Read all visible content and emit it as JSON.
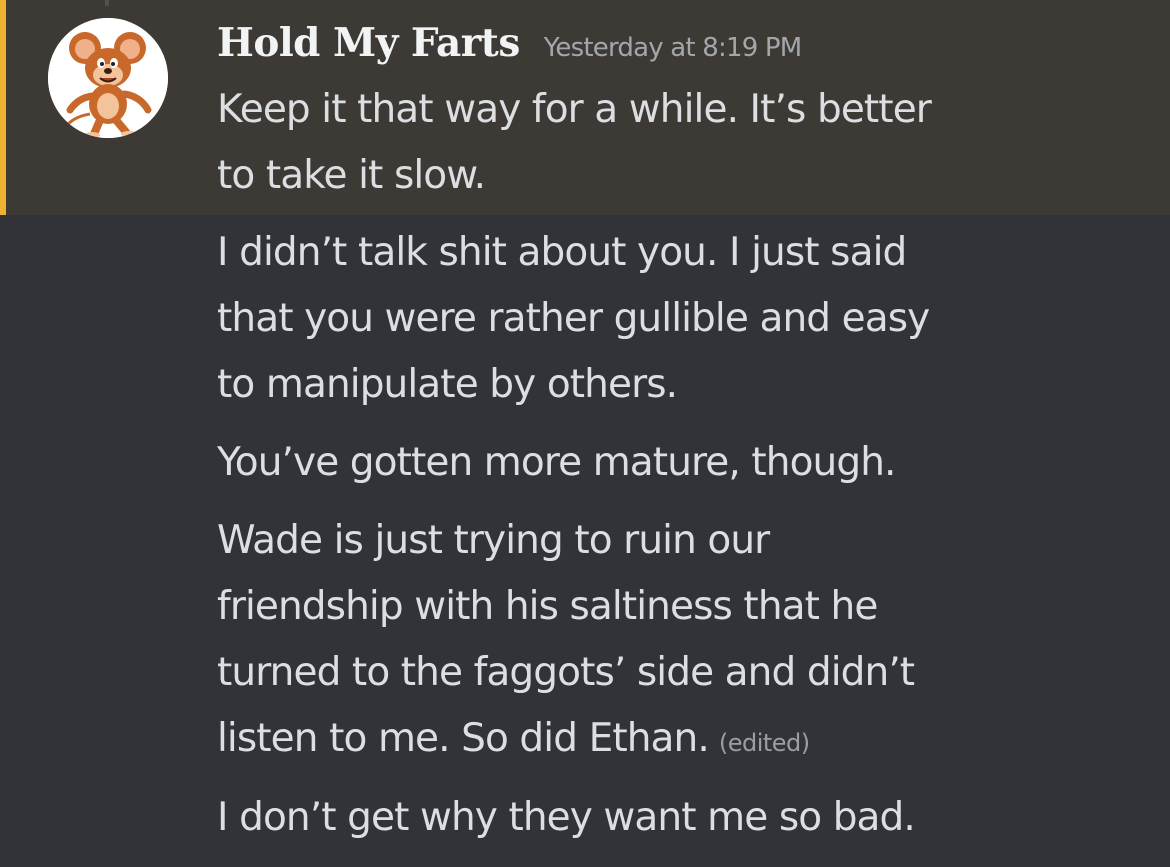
{
  "colors": {
    "background": "#313338",
    "highlight_background": "#3d3a36",
    "mention_bar": "#f0b232",
    "username": "#f2f3f5",
    "message_text": "#dcdee1",
    "timestamp": "#a3a6aa"
  },
  "author": {
    "name": "Hold My Farts",
    "avatar_icon": "cartoon-mouse-avatar-icon"
  },
  "timestamp": "Yesterday at 8:19 PM",
  "messages": [
    {
      "text": "Keep it that way for a while. It’s better\nto take it slow.",
      "edited": ""
    },
    {
      "text": "I didn’t talk shit about you. I just said\nthat you were rather gullible and easy\nto manipulate by others.",
      "edited": ""
    },
    {
      "text": "You’ve gotten more mature, though.",
      "edited": ""
    },
    {
      "text": "Wade is just trying to ruin our\nfriendship with his saltiness that he\nturned to the faggots’ side and didn’t\nlisten to me. So did Ethan.",
      "edited": "(edited)"
    },
    {
      "text": "I don’t get why they want me so bad.",
      "edited": ""
    }
  ]
}
